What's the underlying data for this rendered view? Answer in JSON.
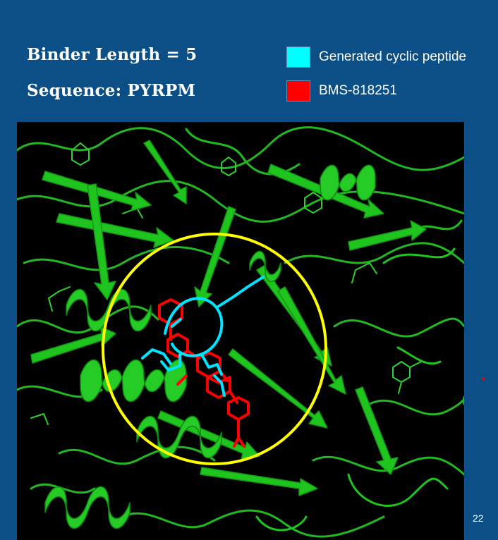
{
  "slide": {
    "binder_length": "Binder Length = 5",
    "sequence": "Sequence: PYRPM",
    "page_number": "22"
  },
  "legend": [
    {
      "label": "Generated cyclic peptide",
      "color": "#00ffff"
    },
    {
      "label": "BMS-818251",
      "color": "#ff0000"
    }
  ],
  "colors": {
    "background": "#0b4f86",
    "protein": "#1fc41f",
    "peptide": "#00ffff",
    "ligand": "#ff0000",
    "highlight_circle": "#ffff00",
    "panel": "#000000"
  },
  "structure_image": {
    "content": "green protein ribbon structure with cyan cyclic peptide and red BMS-818251 ligand inside a yellow highlight circle"
  }
}
